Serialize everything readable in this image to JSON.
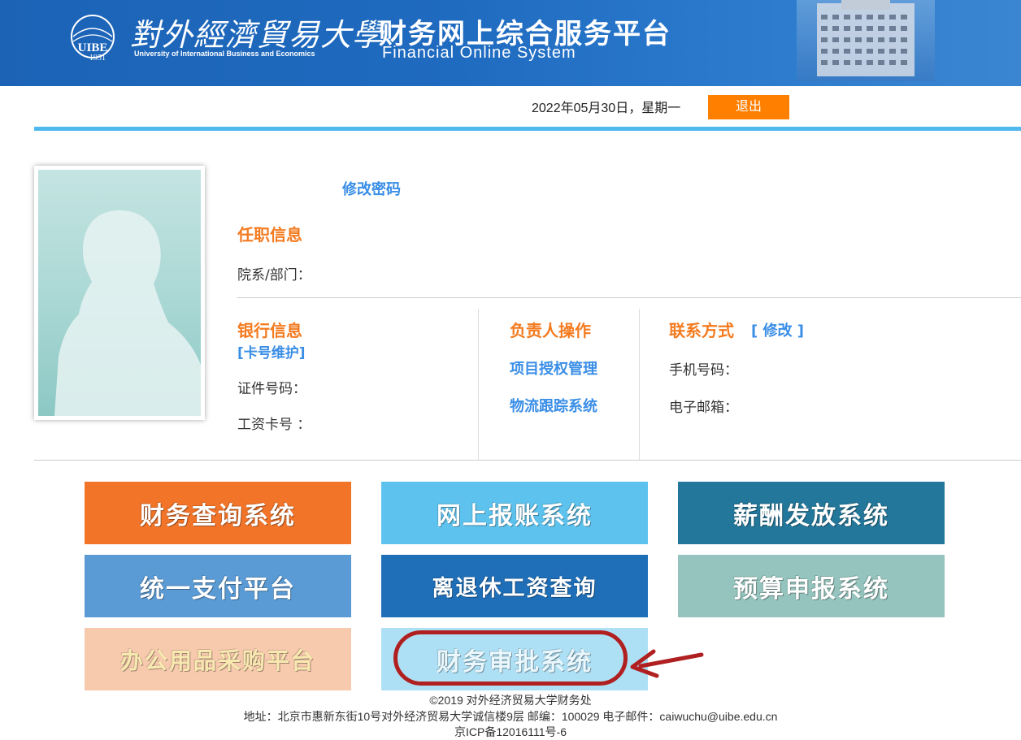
{
  "header": {
    "logo_cn": "對外經濟貿易大學",
    "logo_en": "University of International Business and Economics",
    "logo_year": "1951",
    "logo_abbr": "UIBE",
    "platform_cn": "财务网上综合服务平台",
    "platform_en": "Financial Online System",
    "bg_color": "#1f6bc0"
  },
  "topbar": {
    "date": "2022年05月30日，星期一",
    "logout_label": "退出",
    "logout_color": "#ff7f00"
  },
  "profile": {
    "change_password": "修改密码"
  },
  "employment": {
    "title": "任职信息",
    "department_label": "院系/部门："
  },
  "bank": {
    "title": "银行信息",
    "card_maintain": "[卡号维护]",
    "id_label": "证件号码：",
    "salary_card_label": "工资卡号 ："
  },
  "manager": {
    "title": "负责人操作",
    "links": [
      "项目授权管理",
      "物流跟踪系统"
    ]
  },
  "contact": {
    "title": "联系方式",
    "edit_label": "[ 修改 ]",
    "phone_label": "手机号码：",
    "email_label": "电子邮箱："
  },
  "tiles": [
    {
      "label": "财务查询系统",
      "color": "#f27428"
    },
    {
      "label": "网上报账系统",
      "color": "#5dc3ee"
    },
    {
      "label": "薪酬发放系统",
      "color": "#23779a"
    },
    {
      "label": "统一支付平台",
      "color": "#5b9bd5"
    },
    {
      "label": "离退休工资查询",
      "color": "#1f6fb8"
    },
    {
      "label": "预算申报系统",
      "color": "#94c4bd"
    },
    {
      "label": "办公用品采购平台",
      "color": "#f7c9ad"
    },
    {
      "label": "财务审批系统",
      "color": "#aee0f5"
    }
  ],
  "footer": {
    "copyright": "©2019 对外经济贸易大学财务处",
    "address": "地址：北京市惠新东街10号对外经济贸易大学诚信楼9层 邮编：100029 电子邮件：caiwuchu@uibe.edu.cn",
    "icp": "京ICP备12016111号-6"
  }
}
